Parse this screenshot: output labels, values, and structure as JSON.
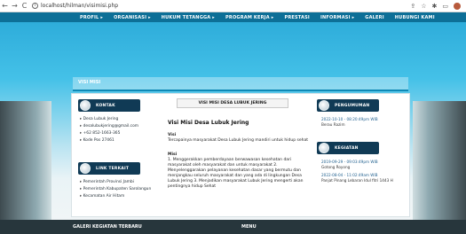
{
  "browser": {
    "url": "localhost/hilman/visimisi.php",
    "back": "←",
    "forward": "→",
    "reload": "C",
    "icons": [
      "share-icon",
      "star-icon",
      "extensions-icon",
      "window-icon"
    ]
  },
  "menu": [
    "PROFIL ▸",
    "ORGANISASI ▸",
    "HUKUM TETANGGA ▸",
    "PROGRAM KERJA ▸",
    "PRESTASI",
    "INFORMASI ▸",
    "GALERI",
    "HUBUNGI KAMI"
  ],
  "breadcrumb": "VISI MISI",
  "kontak": {
    "title": "KONTAK",
    "items": [
      "Desa Lubuk Jering",
      "desalubukjering@gmail.com",
      "+62 852-1663-365",
      "Kode Pos 27461"
    ]
  },
  "link": {
    "title": "LINK TERKAIT",
    "items": [
      "Pemerintah Provinsi Jambi",
      "Pemerintah Kabupaten Sarolangun",
      "Kecamatan Air Hitam"
    ]
  },
  "main": {
    "tab": "VISI MISI DESA LUBUK JERING",
    "heading": "Visi Misi Desa Lubuk Jering",
    "visi_label": "Visi",
    "visi_text": "Tercapainya masyarakat Desa Lubuk Jering mandiri untuk hidup sehat",
    "misi_label": "Misi",
    "misi_text": "1. Menggerakkan pemberdayaan berwawasan kesehatan dari masyarakat oleh masyarakat dan untuk masyarakat 2. Menyelenggarakan pelayanan kesehatan dasar yang bermutu dan menjangkau seluruh masyarakat dan yang ada di lingkungan Desa Lubuk Jering 3. Menjadikan masyarakat Lubuk Jering mengerti akan pentingnya hidup Sehat"
  },
  "pengumuman": {
    "title": "PENGUMUMAN",
    "items": [
      {
        "date": "2022-10-10 - 08:20:49pm WIB",
        "text": "Berau Razim"
      }
    ]
  },
  "kegiatan": {
    "title": "KEGIATAN",
    "items": [
      {
        "date": "2019-09-29 - 09:03:49pm WIB",
        "text": "Gotong Royong"
      },
      {
        "date": "2022-08-04 - 11:02:49am WIB",
        "text": "Panjat Pinang Lebaran Idul fitri 1443 H"
      }
    ]
  },
  "footer": {
    "left": "GALERI KEGIATAN TERBARU",
    "right": "MENU"
  }
}
